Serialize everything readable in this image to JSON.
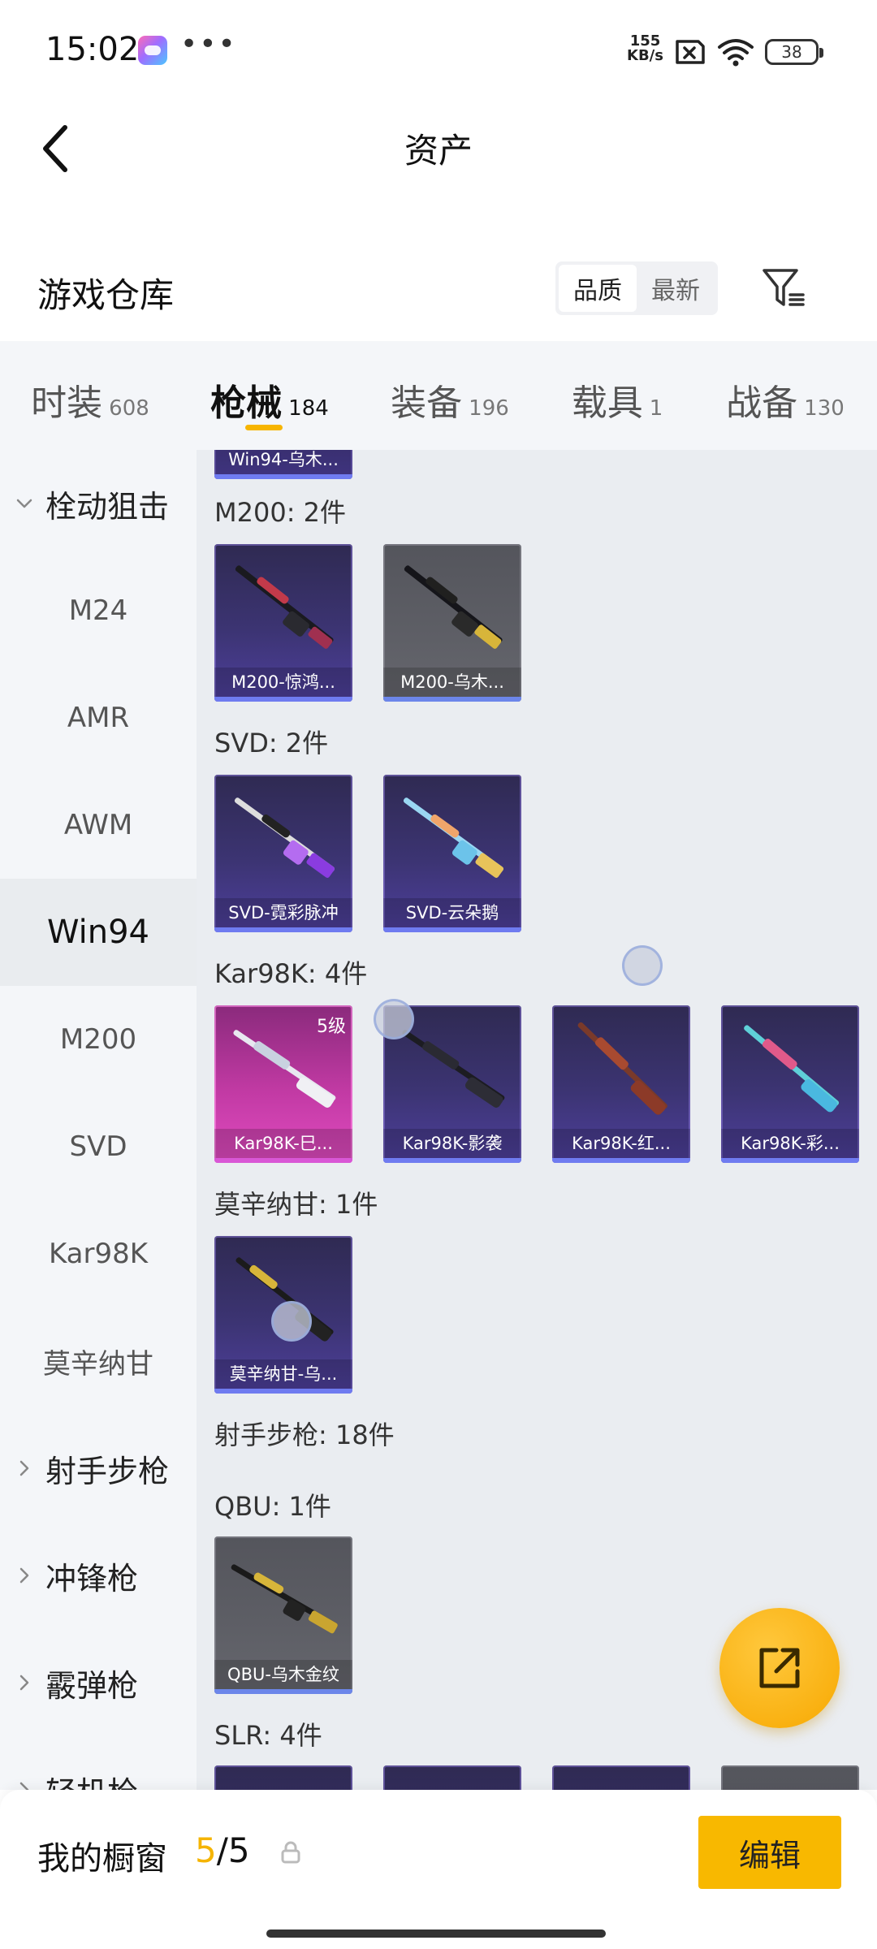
{
  "status_bar": {
    "time": "15:02",
    "dots": "•••",
    "net_speed_value": "155",
    "net_speed_unit": "KB/s",
    "battery": "38"
  },
  "header": {
    "title": "资产"
  },
  "section": {
    "title": "游戏仓库",
    "sort_options": [
      "品质",
      "最新"
    ],
    "active_sort": "品质"
  },
  "tabs": [
    {
      "label": "时装",
      "count": "608"
    },
    {
      "label": "枪械",
      "count": "184",
      "active": true
    },
    {
      "label": "装备",
      "count": "196"
    },
    {
      "label": "载具",
      "count": "1"
    },
    {
      "label": "战备",
      "count": "130"
    }
  ],
  "sidebar": {
    "items": [
      {
        "label": "栓动狙击",
        "type": "group",
        "expanded": true
      },
      {
        "label": "M24"
      },
      {
        "label": "AMR"
      },
      {
        "label": "AWM"
      },
      {
        "label": "Win94",
        "active": true
      },
      {
        "label": "M200"
      },
      {
        "label": "SVD"
      },
      {
        "label": "Kar98K"
      },
      {
        "label": "莫辛纳甘"
      },
      {
        "label": "射手步枪",
        "type": "group",
        "expanded": false
      },
      {
        "label": "冲锋枪",
        "type": "group",
        "expanded": false
      },
      {
        "label": "霰弹枪",
        "type": "group",
        "expanded": false
      },
      {
        "label": "轻机枪",
        "type": "group",
        "expanded": false
      }
    ]
  },
  "content": {
    "top_partial_card": "Win94-乌木...",
    "groups": [
      {
        "title": "M200: 2件",
        "cards": [
          {
            "name": "M200-惊鸿...",
            "style": "purple"
          },
          {
            "name": "M200-乌木...",
            "style": "grey"
          }
        ]
      },
      {
        "title": "SVD: 2件",
        "cards": [
          {
            "name": "SVD-霓彩脉冲",
            "style": "purple"
          },
          {
            "name": "SVD-云朵鹅",
            "style": "purple"
          }
        ]
      },
      {
        "title": "Kar98K: 4件",
        "cards": [
          {
            "name": "Kar98K-巳...",
            "style": "pink",
            "level": "5级"
          },
          {
            "name": "Kar98K-影袭",
            "style": "purple"
          },
          {
            "name": "Kar98K-红...",
            "style": "purple"
          },
          {
            "name": "Kar98K-彩...",
            "style": "purple"
          }
        ]
      },
      {
        "title": "莫辛纳甘: 1件",
        "cards": [
          {
            "name": "莫辛纳甘-乌...",
            "style": "purple"
          }
        ]
      },
      {
        "title": "射手步枪: 18件",
        "cards": []
      },
      {
        "title": "QBU: 1件",
        "cards": [
          {
            "name": "QBU-乌木金纹",
            "style": "grey"
          }
        ]
      },
      {
        "title": "SLR: 4件",
        "cards": [
          {
            "name": "",
            "style": "purple"
          },
          {
            "name": "",
            "style": "purple"
          },
          {
            "name": "",
            "style": "purple"
          },
          {
            "name": "",
            "style": "grey"
          }
        ]
      }
    ]
  },
  "showcase": {
    "label": "我的橱窗",
    "current": "5",
    "separator": "/",
    "total": "5"
  },
  "edit_button": "编辑",
  "colors": {
    "accent": "#f8b800",
    "card_purple": "#3c3473",
    "card_grey": "#5e5f66",
    "card_pink": "#c23aa4"
  }
}
